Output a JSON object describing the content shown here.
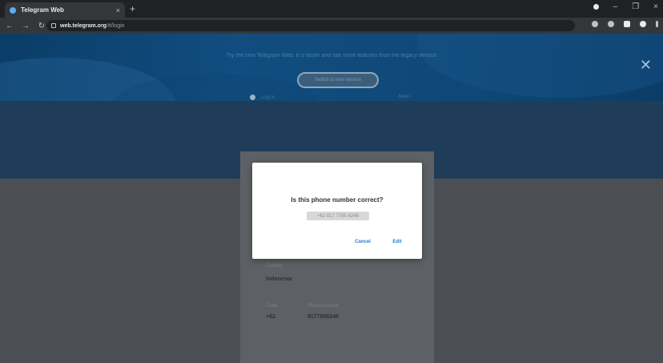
{
  "browser": {
    "tab_title": "Telegram Web",
    "tab_close": "×",
    "new_tab": "+",
    "url_host": "web.telegram.org",
    "url_path": "/#/login",
    "window_controls": [
      "–",
      "❐",
      "×"
    ]
  },
  "banner": {
    "text": "Try the new Telegram Web, it is faster and has more features than the legacy version.",
    "button_label": "Switch to new version",
    "close_glyph": "✕"
  },
  "login": {
    "step_label": "Log in",
    "next_label": "Next ›",
    "country_label": "Country",
    "country_value": "Indonesia",
    "code_label": "Code",
    "code_value": "+62",
    "phone_label": "Phone number",
    "phone_value": "8177856246"
  },
  "dialog": {
    "title": "Is this phone number correct?",
    "phone": "+62 817 7785 6246",
    "cancel_label": "Cancel",
    "edit_label": "Edit"
  },
  "colors": {
    "accent": "#2b7cd3",
    "banner": "#114d80",
    "header_band": "#1f3d59"
  }
}
